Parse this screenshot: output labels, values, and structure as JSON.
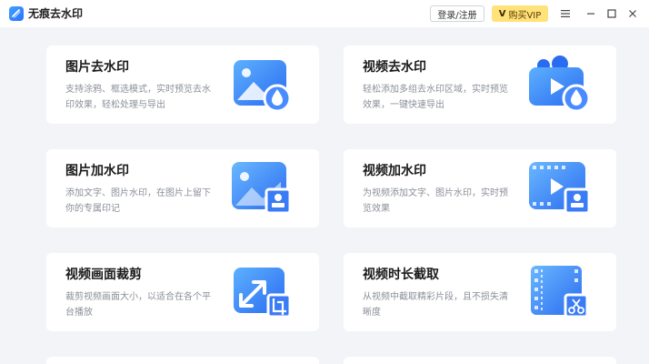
{
  "app": {
    "title": "无痕去水印"
  },
  "header": {
    "login_label": "登录/注册",
    "vip_label": "购买VIP"
  },
  "colors": {
    "accent": "#2b6fff",
    "vip": "#ffe27a",
    "background": "#f2f4f8"
  },
  "cards": [
    {
      "title": "图片去水印",
      "desc": "支持涂鸦、框选模式，实时预览去水印效果，轻松处理与导出",
      "icon": "image-remove-watermark-icon"
    },
    {
      "title": "视频去水印",
      "desc": "轻松添加多组去水印区域，实时预览效果，一键快速导出",
      "icon": "video-remove-watermark-icon"
    },
    {
      "title": "图片加水印",
      "desc": "添加文字、图片水印，在图片上留下你的专属印记",
      "icon": "image-add-watermark-icon"
    },
    {
      "title": "视频加水印",
      "desc": "为视频添加文字、图片水印，实时预览效果",
      "icon": "video-add-watermark-icon"
    },
    {
      "title": "视频画面裁剪",
      "desc": "裁剪视频画面大小，以适合在各个平台播放",
      "icon": "video-crop-icon"
    },
    {
      "title": "视频时长截取",
      "desc": "从视频中截取精彩片段，且不损失清晰度",
      "icon": "video-trim-icon"
    }
  ]
}
